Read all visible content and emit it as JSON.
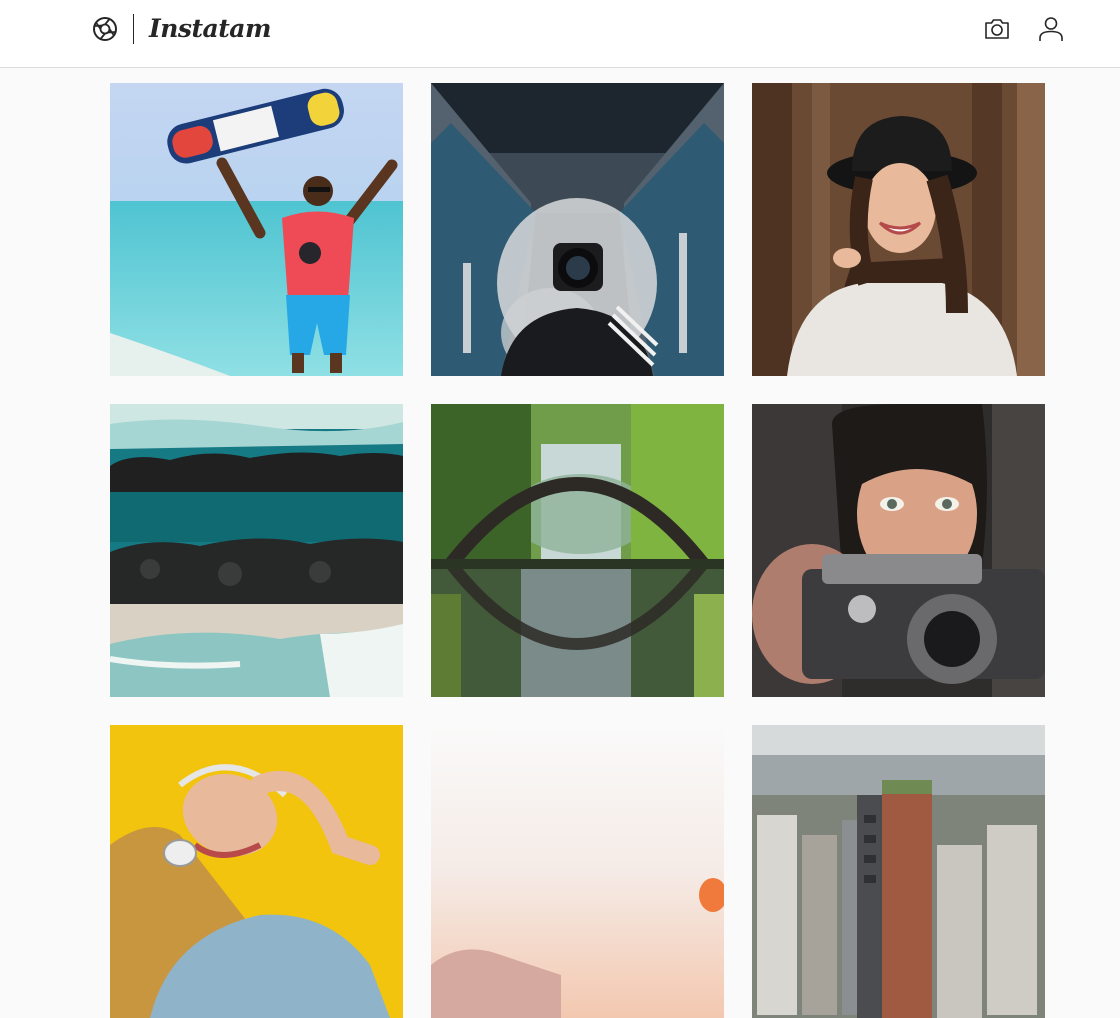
{
  "header": {
    "brand_name": "Instatam",
    "logo_icon": "camera-aperture-icon",
    "upload_icon": "camera-icon",
    "profile_icon": "user-icon"
  },
  "colors": {
    "border": "#dbdbdb",
    "text": "#262626",
    "background": "#fafafa"
  },
  "feed": {
    "posts": [
      {
        "photo": "surfer-with-wakeboard-beach"
      },
      {
        "photo": "photographer-on-escalator-with-smoke"
      },
      {
        "photo": "woman-in-black-hat-smiling"
      },
      {
        "photo": "rocky-breakwater-ocean"
      },
      {
        "photo": "stone-arch-bridge-reflection"
      },
      {
        "photo": "woman-holding-vintage-camera"
      },
      {
        "photo": "woman-with-headphones-yellow-wall"
      },
      {
        "photo": "sunset-sky-hot-air-balloon"
      },
      {
        "photo": "city-skyline-towers"
      }
    ]
  }
}
